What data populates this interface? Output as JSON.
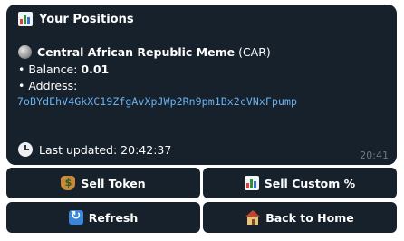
{
  "message": {
    "title": "Your Positions",
    "token_name": "Central African Republic Meme",
    "token_symbol": "(CAR)",
    "balance_label": "• Balance: ",
    "balance_value": "0.01",
    "address_label": "• Address:",
    "address_value": "7oBYdEhV4GkXC19ZfgAvXpJWp2Rn9pm1Bx2cVNxFpump",
    "updated_label": "Last updated: 20:42:37",
    "time": "20:41"
  },
  "keyboard": {
    "sell_token": "Sell Token",
    "sell_custom": "Sell Custom %",
    "refresh": "Refresh",
    "back_home": "Back to Home"
  },
  "icons": {
    "title": "bar-chart-icon",
    "token": "coin-icon",
    "updated": "clock-icon",
    "sell_token": "money-bag-icon",
    "sell_custom": "bar-chart-icon",
    "refresh": "refresh-icon",
    "back_home": "house-icon"
  },
  "colors": {
    "bubble_bg": "#17212b",
    "link": "#6ab3f3",
    "meta_time": "#6d7883"
  }
}
